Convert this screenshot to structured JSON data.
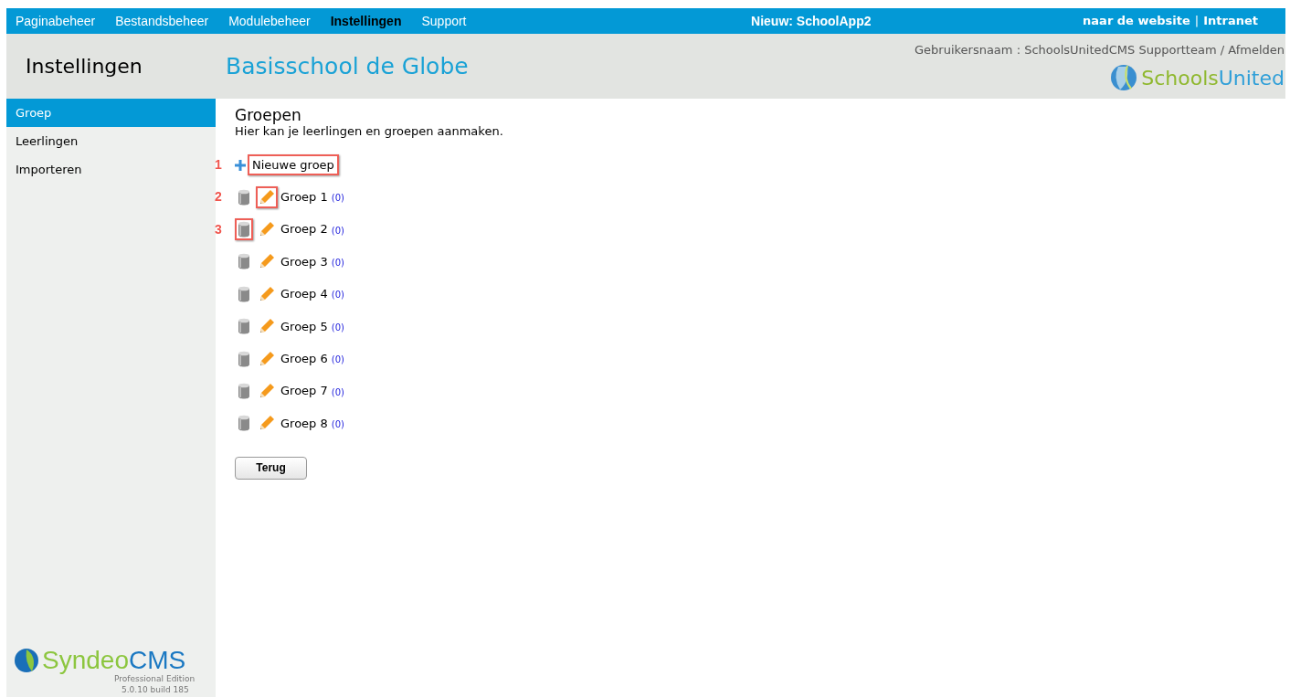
{
  "top_nav": {
    "items": [
      {
        "label": "Paginabeheer",
        "selected": false
      },
      {
        "label": "Bestandsbeheer",
        "selected": false
      },
      {
        "label": "Modulebeheer",
        "selected": false
      },
      {
        "label": "Instellingen",
        "selected": true
      },
      {
        "label": "Support",
        "selected": false
      }
    ],
    "announcement": "Nieuw: SchoolApp2",
    "links": [
      "naar de website",
      "Intranet"
    ],
    "separator": "|"
  },
  "header": {
    "section_title": "Instellingen",
    "site_title": "Basisschool de Globe",
    "user_line": "Gebruikersnaam : SchoolsUnitedCMS Supportteam / Afmelden",
    "logo": [
      "Schools",
      "United"
    ]
  },
  "sidebar": {
    "items": [
      {
        "label": "Groep",
        "selected": true
      },
      {
        "label": "Leerlingen",
        "selected": false
      },
      {
        "label": "Importeren",
        "selected": false
      }
    ],
    "logo": [
      "Syndeo",
      "CMS"
    ],
    "edition": "Professional Edition",
    "version": "5.0.10 build 185"
  },
  "content": {
    "title": "Groepen",
    "description": "Hier kan je leerlingen en groepen aanmaken.",
    "new_group": {
      "label": "Nieuwe groep",
      "callout": "1"
    },
    "groups": [
      {
        "name": "Groep 1",
        "count": "(0)",
        "callout": "2",
        "delete_highlighted": false,
        "edit_highlighted": true
      },
      {
        "name": "Groep 2",
        "count": "(0)",
        "callout": "3",
        "delete_highlighted": true,
        "edit_highlighted": false
      },
      {
        "name": "Groep 3",
        "count": "(0)",
        "delete_highlighted": false,
        "edit_highlighted": false
      },
      {
        "name": "Groep 4",
        "count": "(0)",
        "delete_highlighted": false,
        "edit_highlighted": false
      },
      {
        "name": "Groep 5",
        "count": "(0)",
        "delete_highlighted": false,
        "edit_highlighted": false
      },
      {
        "name": "Groep 6",
        "count": "(0)",
        "delete_highlighted": false,
        "edit_highlighted": false
      },
      {
        "name": "Groep 7",
        "count": "(0)",
        "delete_highlighted": false,
        "edit_highlighted": false
      },
      {
        "name": "Groep 8",
        "count": "(0)",
        "delete_highlighted": false,
        "edit_highlighted": false
      }
    ],
    "back_button": "Terug"
  }
}
